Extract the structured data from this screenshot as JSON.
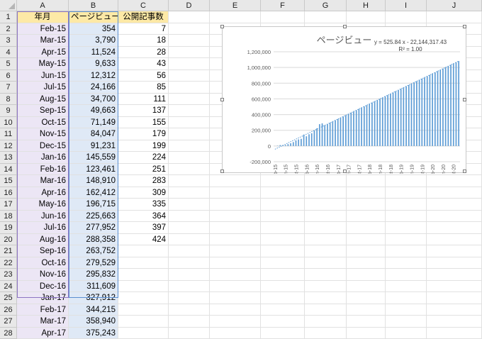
{
  "sheet": {
    "columns": [
      "A",
      "B",
      "C",
      "D",
      "E",
      "F",
      "G",
      "H",
      "I",
      "J"
    ],
    "rows": [
      "1",
      "2",
      "3",
      "4",
      "5",
      "6",
      "7",
      "8",
      "9",
      "10",
      "11",
      "12",
      "13",
      "14",
      "15",
      "16",
      "17",
      "18",
      "19",
      "20",
      "21",
      "22",
      "23",
      "24",
      "25",
      "26",
      "27",
      "28"
    ],
    "headers": {
      "A": "年月",
      "B": "ページビュー",
      "C": "公開記事数"
    },
    "data": [
      {
        "month": "Feb-15",
        "pv": "354",
        "posts": "7"
      },
      {
        "month": "Mar-15",
        "pv": "3,790",
        "posts": "18"
      },
      {
        "month": "Apr-15",
        "pv": "11,524",
        "posts": "28"
      },
      {
        "month": "May-15",
        "pv": "9,633",
        "posts": "43"
      },
      {
        "month": "Jun-15",
        "pv": "12,312",
        "posts": "56"
      },
      {
        "month": "Jul-15",
        "pv": "24,166",
        "posts": "85"
      },
      {
        "month": "Aug-15",
        "pv": "34,700",
        "posts": "111"
      },
      {
        "month": "Sep-15",
        "pv": "49,663",
        "posts": "137"
      },
      {
        "month": "Oct-15",
        "pv": "71,149",
        "posts": "155"
      },
      {
        "month": "Nov-15",
        "pv": "84,047",
        "posts": "179"
      },
      {
        "month": "Dec-15",
        "pv": "91,231",
        "posts": "199"
      },
      {
        "month": "Jan-16",
        "pv": "145,559",
        "posts": "224"
      },
      {
        "month": "Feb-16",
        "pv": "123,461",
        "posts": "251"
      },
      {
        "month": "Mar-16",
        "pv": "148,910",
        "posts": "283"
      },
      {
        "month": "Apr-16",
        "pv": "162,412",
        "posts": "309"
      },
      {
        "month": "May-16",
        "pv": "196,715",
        "posts": "335"
      },
      {
        "month": "Jun-16",
        "pv": "225,663",
        "posts": "364"
      },
      {
        "month": "Jul-16",
        "pv": "277,952",
        "posts": "397"
      },
      {
        "month": "Aug-16",
        "pv": "288,358",
        "posts": "424"
      },
      {
        "month": "Sep-16",
        "pv": "263,752",
        "posts": ""
      },
      {
        "month": "Oct-16",
        "pv": "279,529",
        "posts": ""
      },
      {
        "month": "Nov-16",
        "pv": "295,832",
        "posts": ""
      },
      {
        "month": "Dec-16",
        "pv": "311,609",
        "posts": ""
      },
      {
        "month": "Jan-17",
        "pv": "327,912",
        "posts": ""
      },
      {
        "month": "Feb-17",
        "pv": "344,215",
        "posts": ""
      },
      {
        "month": "Mar-17",
        "pv": "358,940",
        "posts": ""
      },
      {
        "month": "Apr-17",
        "pv": "375,243",
        "posts": ""
      }
    ]
  },
  "colors": {
    "header_fill": "#fde9a6",
    "colA_fill": "#ece6f5",
    "colB_fill": "#dfe9f6",
    "bar": "#5b9bd5",
    "trend": "#5b9bd5"
  },
  "chart_data": {
    "type": "bar",
    "title": "ページビュー",
    "trendline": {
      "type": "linear",
      "equation": "y = 525.84 x - 22,144,317.43",
      "r2": "R² = 1.00"
    },
    "ylim": [
      -200000,
      1200000
    ],
    "yticks": [
      "-200,000",
      "0",
      "200,000",
      "400,000",
      "600,000",
      "800,000",
      "1,000,000",
      "1,200,000"
    ],
    "x_tick_labels": [
      "Feb-15",
      "Jun-15",
      "Oct-15",
      "Feb-16",
      "Jun-16",
      "Oct-16",
      "Feb-17",
      "Jun-17",
      "Oct-17",
      "Feb-18",
      "Jun-18",
      "Oct-18",
      "Feb-19",
      "Jun-19",
      "Oct-19",
      "Feb-20",
      "Jun-20",
      "Oct-20"
    ],
    "x_tick_every": 4,
    "categories_count": 71,
    "series": [
      {
        "values": [
          354,
          3790,
          11524,
          9633,
          12312,
          24166,
          34700,
          49663,
          71149,
          84047,
          91231,
          145559,
          123461,
          148910,
          162412,
          196715,
          225663,
          277952,
          288358,
          263752,
          279529,
          295832,
          311609,
          327912,
          344215,
          358940,
          375243,
          391546,
          407323,
          423626,
          439403,
          455706,
          472009,
          487786,
          504089,
          519866,
          536169,
          552472,
          567197,
          583500,
          599803,
          615580,
          631883,
          647660,
          663963,
          680266,
          696043,
          712346,
          728123,
          744426,
          760729,
          776506,
          792809,
          809112,
          824363,
          840666,
          856969,
          872746,
          889049,
          904826,
          921129,
          937432,
          953209,
          969512,
          985289,
          1001592,
          1017895,
          1033672,
          1049975,
          1065752,
          1082055
        ]
      }
    ]
  }
}
